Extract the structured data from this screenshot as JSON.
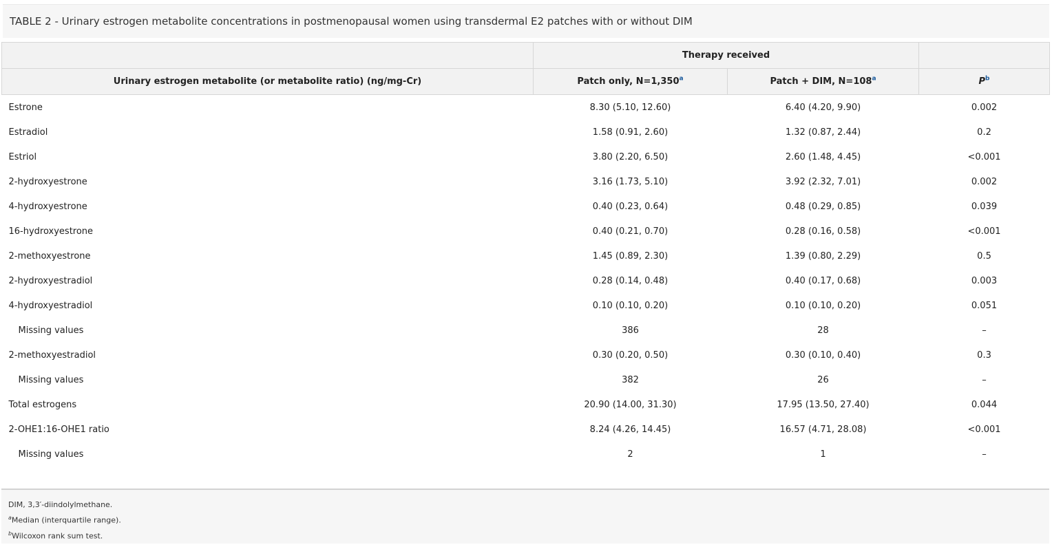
{
  "caption": "TABLE 2 - Urinary estrogen metabolite concentrations in postmenopausal women using transdermal E2 patches with or without DIM",
  "header": {
    "group_label": "Therapy received",
    "col0": "Urinary estrogen metabolite (or metabolite ratio) (ng/mg-Cr)",
    "col1": "Patch only, N=1,350",
    "col1_sup": "a",
    "col2": "Patch + DIM, N=108",
    "col2_sup": "a",
    "col3": "P",
    "col3_sup": "b"
  },
  "rows": [
    {
      "label": "Estrone",
      "patch": "8.30 (5.10, 12.60)",
      "dim": "6.40 (4.20, 9.90)",
      "p": "0.002"
    },
    {
      "label": "Estradiol",
      "patch": "1.58 (0.91, 2.60)",
      "dim": "1.32 (0.87, 2.44)",
      "p": "0.2"
    },
    {
      "label": "Estriol",
      "patch": "3.80 (2.20, 6.50)",
      "dim": "2.60 (1.48, 4.45)",
      "p": "<0.001"
    },
    {
      "label": "2-hydroxyestrone",
      "patch": "3.16 (1.73, 5.10)",
      "dim": "3.92 (2.32, 7.01)",
      "p": "0.002"
    },
    {
      "label": "4-hydroxyestrone",
      "patch": "0.40 (0.23, 0.64)",
      "dim": "0.48 (0.29, 0.85)",
      "p": "0.039"
    },
    {
      "label": "16-hydroxyestrone",
      "patch": "0.40 (0.21, 0.70)",
      "dim": "0.28 (0.16, 0.58)",
      "p": "<0.001"
    },
    {
      "label": "2-methoxyestrone",
      "patch": "1.45 (0.89, 2.30)",
      "dim": "1.39 (0.80, 2.29)",
      "p": "0.5"
    },
    {
      "label": "2-hydroxyestradiol",
      "patch": "0.28 (0.14, 0.48)",
      "dim": "0.40 (0.17, 0.68)",
      "p": "0.003"
    },
    {
      "label": "4-hydroxyestradiol",
      "patch": "0.10 (0.10, 0.20)",
      "dim": "0.10 (0.10, 0.20)",
      "p": "0.051"
    },
    {
      "label": "Missing values",
      "patch": "386",
      "dim": "28",
      "p": "–"
    },
    {
      "label": "2-methoxyestradiol",
      "patch": "0.30 (0.20, 0.50)",
      "dim": "0.30 (0.10, 0.40)",
      "p": "0.3"
    },
    {
      "label": "Missing values",
      "patch": "382",
      "dim": "26",
      "p": "–"
    },
    {
      "label": "Total estrogens",
      "patch": "20.90 (14.00, 31.30)",
      "dim": "17.95 (13.50, 27.40)",
      "p": "0.044"
    },
    {
      "label": "2-OHE1:16-OHE1 ratio",
      "patch": "8.24 (4.26, 14.45)",
      "dim": "16.57 (4.71, 28.08)",
      "p": "<0.001"
    },
    {
      "label": "Missing values",
      "patch": "2",
      "dim": "1",
      "p": "–"
    }
  ],
  "footnotes": {
    "abbrev": "DIM, 3,3′-diindolylmethane.",
    "a_mark": "a",
    "a_text": "Median (interquartile range).",
    "b_mark": "b",
    "b_text": "Wilcoxon rank sum test."
  }
}
